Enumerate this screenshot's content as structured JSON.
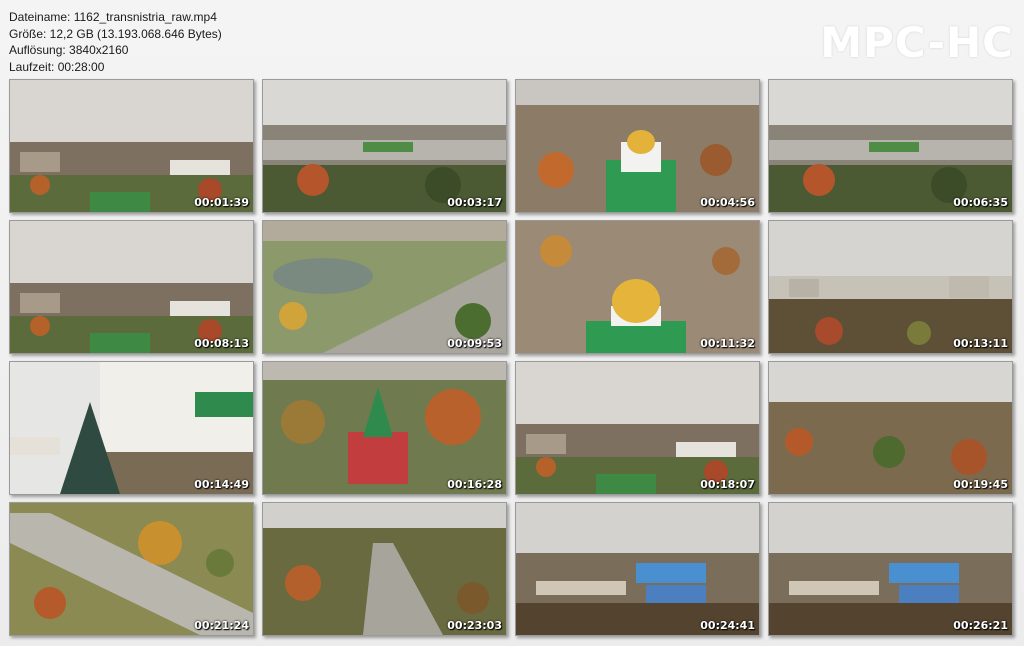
{
  "header": {
    "filename": "Dateiname: 1162_transnistria_raw.mp4",
    "size": "Größe: 12,2 GB (13.193.068.646 Bytes)",
    "resolution": "Auflösung: 3840x2160",
    "duration": "Laufzeit: 00:28:00"
  },
  "logo": "MPC-HC",
  "thumbnails": [
    {
      "time": "00:01:39",
      "scene": "city-sky"
    },
    {
      "time": "00:03:17",
      "scene": "boulevard"
    },
    {
      "time": "00:04:56",
      "scene": "green-church"
    },
    {
      "time": "00:06:35",
      "scene": "boulevard"
    },
    {
      "time": "00:08:13",
      "scene": "city-sky"
    },
    {
      "time": "00:09:53",
      "scene": "park-lake"
    },
    {
      "time": "00:11:32",
      "scene": "gold-dome"
    },
    {
      "time": "00:13:11",
      "scene": "apartments"
    },
    {
      "time": "00:14:49",
      "scene": "white-church"
    },
    {
      "time": "00:16:28",
      "scene": "red-church"
    },
    {
      "time": "00:18:07",
      "scene": "city-sky"
    },
    {
      "time": "00:19:45",
      "scene": "autumn-town"
    },
    {
      "time": "00:21:24",
      "scene": "road-forest"
    },
    {
      "time": "00:23:03",
      "scene": "highway"
    },
    {
      "time": "00:24:41",
      "scene": "stadium"
    },
    {
      "time": "00:26:21",
      "scene": "stadium"
    }
  ]
}
